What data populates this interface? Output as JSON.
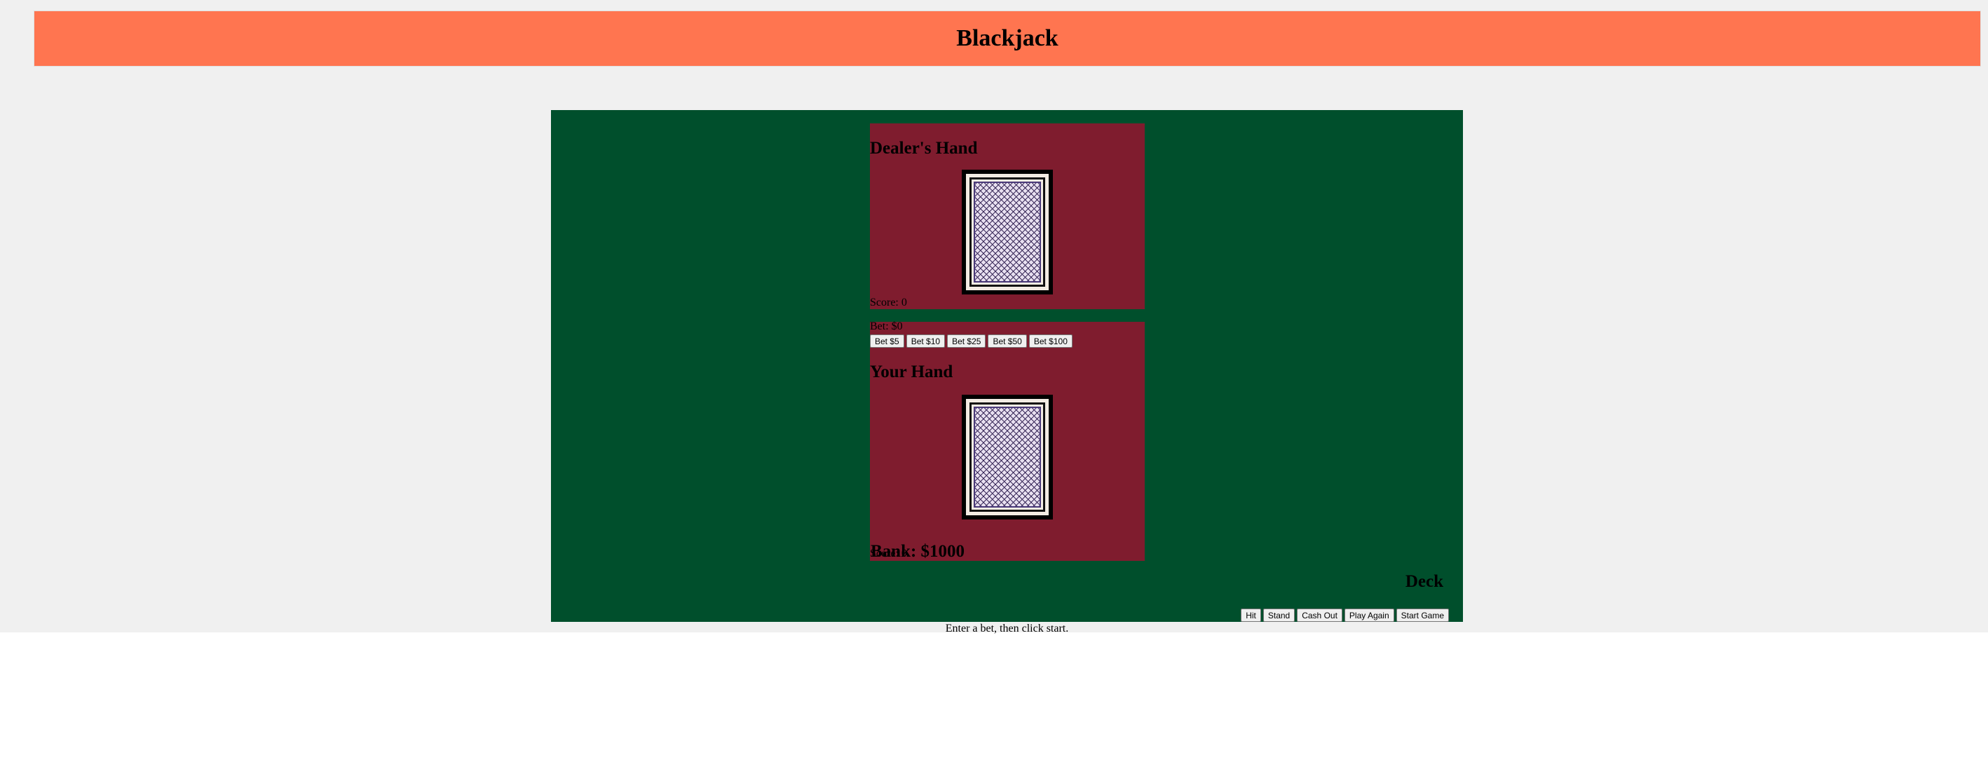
{
  "header": {
    "title": "Blackjack"
  },
  "dealer": {
    "title": "Dealer's Hand",
    "card": "card-back",
    "score_label": "Score: 0"
  },
  "betting": {
    "bet_label": "Bet: $0",
    "buttons": [
      "Bet $5",
      "Bet $10",
      "Bet $25",
      "Bet $50",
      "Bet $100"
    ]
  },
  "player": {
    "title": "Your Hand",
    "card": "card-back",
    "score_label": "Score: 0"
  },
  "bank_label": "Bank: $1000",
  "deck_label": "Deck",
  "actions": [
    "Hit",
    "Stand",
    "Cash Out",
    "Play Again",
    "Start Game"
  ],
  "status_message": "Enter a bet, then click start.",
  "colors": {
    "header": "#ff7550",
    "table": "#004f2c",
    "hand_panel": "#7f1c2e",
    "page": "#f0f0f0"
  }
}
